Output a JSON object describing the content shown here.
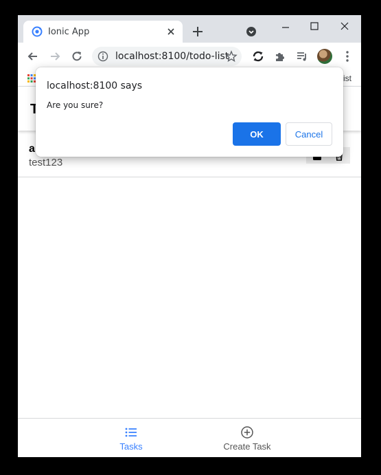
{
  "browser": {
    "tab_title": "Ionic App",
    "url": "localhost:8100/todo-list",
    "bookmarks_tail_text": "ist",
    "accent_color": "#1a73e8"
  },
  "app": {
    "header_title_partial": "T",
    "items": [
      {
        "title_partial": "a",
        "subtitle": "test123"
      }
    ],
    "tabbar": {
      "tasks_label": "Tasks",
      "create_label": "Create Task",
      "active_color": "#3880ff",
      "inactive_color": "#555555"
    }
  },
  "dialog": {
    "title": "localhost:8100 says",
    "message": "Are you sure?",
    "ok_label": "OK",
    "cancel_label": "Cancel"
  }
}
